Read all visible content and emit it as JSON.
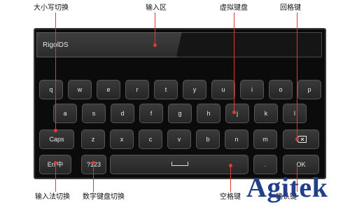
{
  "callouts": {
    "case_toggle": "大小写切换",
    "input_area": "输入区",
    "virtual_keyboard": "虚拟键盘",
    "backspace": "回格键",
    "ime_toggle": "输入法切换",
    "numeric_keyboard": "数字键盘切换",
    "space": "空格键",
    "enter": "确认键"
  },
  "input": {
    "value": "RigolDS"
  },
  "keys": {
    "row1": [
      "q",
      "w",
      "e",
      "r",
      "t",
      "y",
      "u",
      "i",
      "o",
      "p"
    ],
    "row2": [
      "a",
      "s",
      "d",
      "f",
      "g",
      "h",
      "j",
      "k",
      "l"
    ],
    "row3": [
      "Caps",
      "z",
      "x",
      "c",
      "v",
      "b",
      "n",
      "m"
    ],
    "row4": {
      "lang": "En/中",
      "num": "?123",
      "dot": ".",
      "ok": "OK"
    }
  },
  "icons": {
    "backspace": "backspace-icon",
    "space": "space-bar-icon"
  },
  "colors": {
    "leader": "#e23b2e",
    "brand": "#233f8a",
    "key_bg": "#2e2e2e"
  },
  "brand": "Agitek"
}
